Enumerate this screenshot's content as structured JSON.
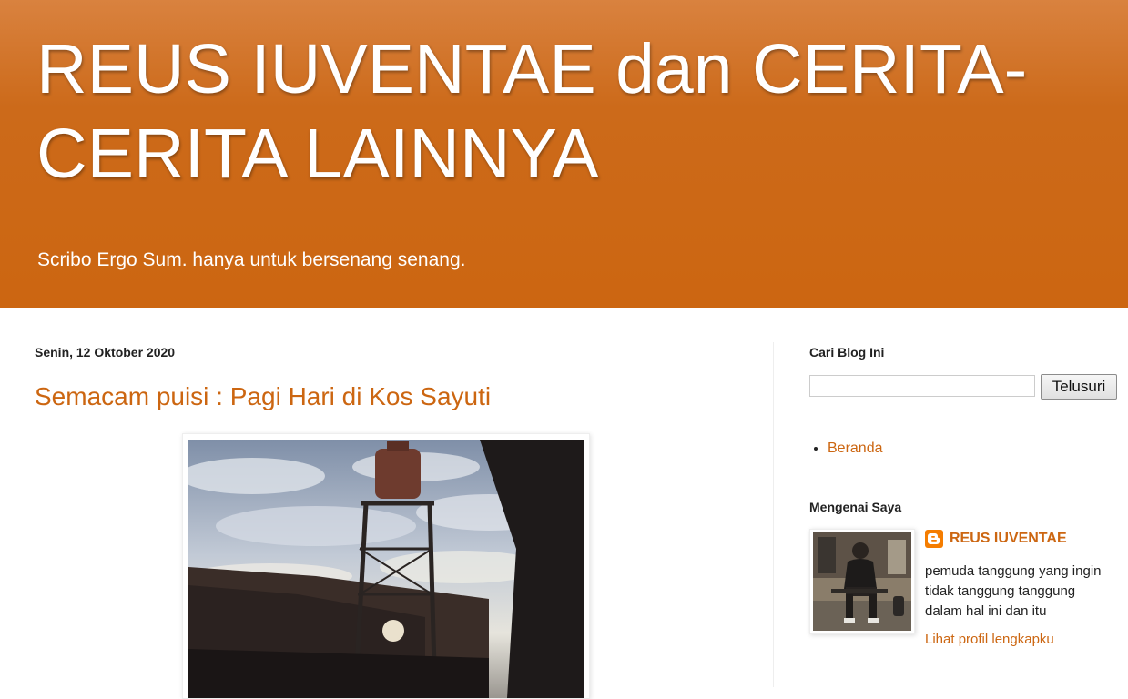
{
  "header": {
    "title": "REUS IUVENTAE dan CERITA-CERITA LAINNYA",
    "description": "Scribo Ergo Sum. hanya untuk bersenang senang."
  },
  "post": {
    "date": "Senin, 12 Oktober 2020",
    "title": "Semacam puisi : Pagi Hari di Kos Sayuti"
  },
  "sidebar": {
    "search": {
      "title": "Cari Blog Ini",
      "input_value": "",
      "button_label": "Telusuri"
    },
    "pages": [
      {
        "label": "Beranda"
      }
    ],
    "profile": {
      "title": "Mengenai Saya",
      "name": "REUS IUVENTAE",
      "description": "pemuda tanggung yang ingin tidak tanggung tanggung dalam hal ini dan itu",
      "link_label": "Lihat profil lengkapku"
    }
  },
  "colors": {
    "header_bg": "#cc6611",
    "link": "#cc6611",
    "text": "#222222"
  },
  "icons": [
    "blogger-icon"
  ]
}
